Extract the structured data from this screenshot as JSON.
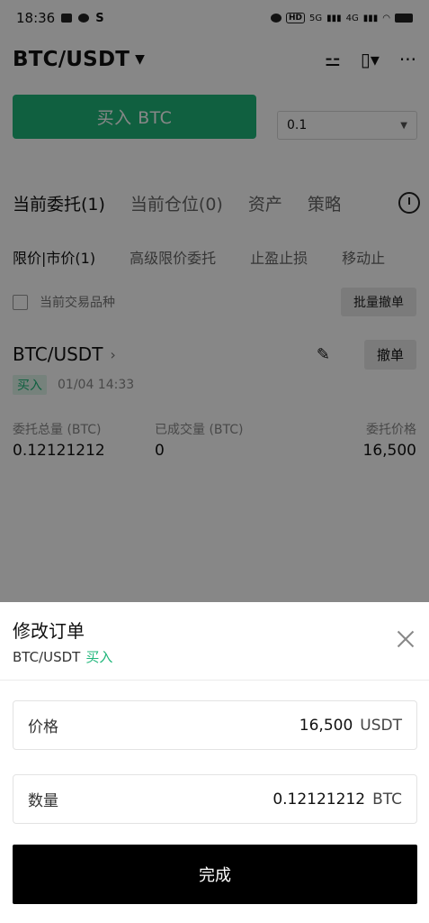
{
  "status_bar": {
    "time": "18:36",
    "battery_label": "HD",
    "signal_1": "5G",
    "signal_2": "4G"
  },
  "header": {
    "pair": "BTC/USDT",
    "caret_icon": "caret-down-icon"
  },
  "trade": {
    "buy_label": "买入 BTC",
    "quantity_value": "0.1"
  },
  "tabs": [
    "当前委托(1)",
    "当前仓位(0)",
    "资产",
    "策略"
  ],
  "subtabs": [
    "限价|市价(1)",
    "高级限价委托",
    "止盈止损",
    "移动止"
  ],
  "filter": {
    "label": "当前交易品种",
    "batch_cancel": "批量撤单"
  },
  "order": {
    "pair": "BTC/USDT",
    "cancel_label": "撤单",
    "side": "买入",
    "timestamp": "01/04 14:33",
    "labels": {
      "total": "委托总量 (BTC)",
      "filled": "已成交量 (BTC)",
      "price": "委托价格"
    },
    "values": {
      "total": "0.12121212",
      "filled": "0",
      "price": "16,500"
    }
  },
  "sheet": {
    "title": "修改订单",
    "pair": "BTC/USDT",
    "side": "买入",
    "price_label": "价格",
    "price_value": "16,500",
    "price_unit": "USDT",
    "amount_label": "数量",
    "amount_value": "0.12121212",
    "amount_unit": "BTC",
    "done_label": "完成"
  },
  "colors": {
    "buy_green": "#1fb67a",
    "overlay": "rgba(0,0,0,0.47)",
    "done_button": "#000000"
  }
}
